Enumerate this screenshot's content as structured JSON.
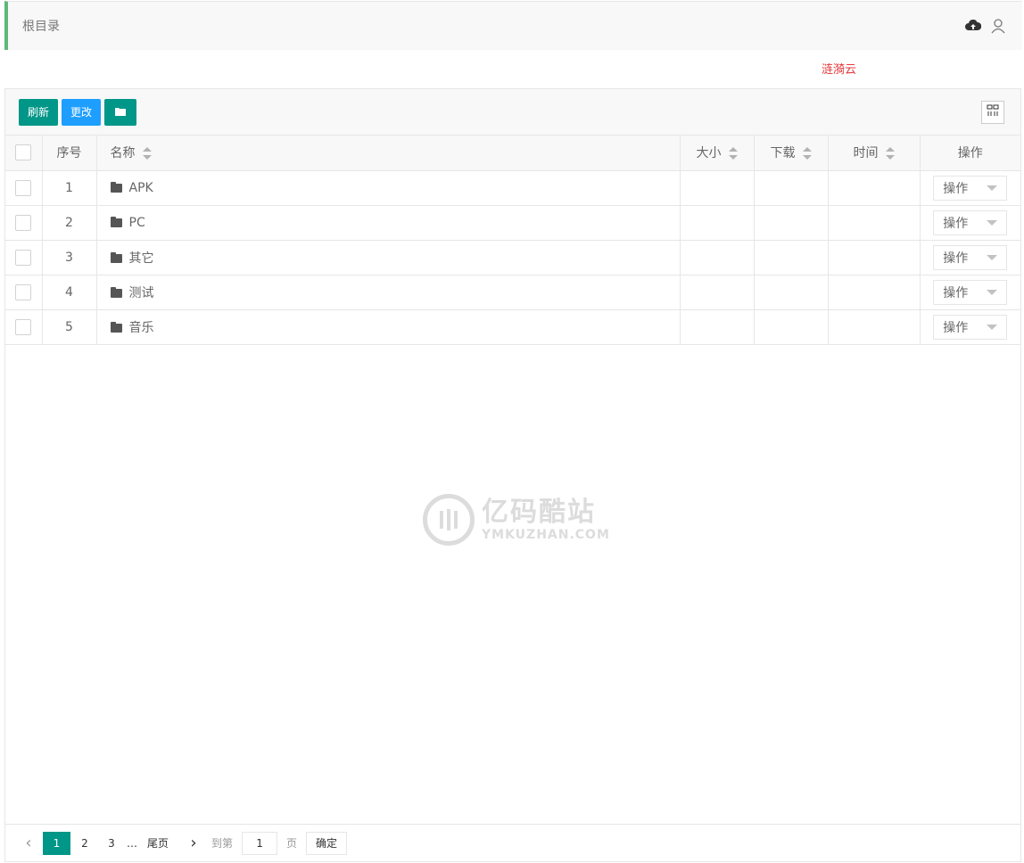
{
  "breadcrumb": {
    "current": "根目录"
  },
  "top_icons": [
    "cloud-upload-icon",
    "user-icon"
  ],
  "brand": {
    "text": "涟漪云",
    "color": "#e4393c"
  },
  "toolbar": {
    "refresh_label": "刷新",
    "change_label": "更改",
    "new_folder_icon": "folder-icon"
  },
  "table": {
    "headers": {
      "index": "序号",
      "name": "名称",
      "size": "大小",
      "download": "下载",
      "time": "时间",
      "action": "操作"
    },
    "rows": [
      {
        "index": "1",
        "name": "APK",
        "size": "",
        "download": "",
        "time": "",
        "action": "操作"
      },
      {
        "index": "2",
        "name": "PC",
        "size": "",
        "download": "",
        "time": "",
        "action": "操作"
      },
      {
        "index": "3",
        "name": "其它",
        "size": "",
        "download": "",
        "time": "",
        "action": "操作"
      },
      {
        "index": "4",
        "name": "测试",
        "size": "",
        "download": "",
        "time": "",
        "action": "操作"
      },
      {
        "index": "5",
        "name": "音乐",
        "size": "",
        "download": "",
        "time": "",
        "action": "操作"
      }
    ]
  },
  "watermark": {
    "title": "亿码酷站",
    "subtitle": "YMKUZHAN.COM"
  },
  "pager": {
    "pages": [
      "1",
      "2",
      "3"
    ],
    "current": "1",
    "ellipsis": "…",
    "last_label": "尾页",
    "goto_label": "到第",
    "goto_value": "1",
    "page_unit": "页",
    "confirm_label": "确定"
  },
  "colors": {
    "accent_green": "#009688",
    "accent_blue": "#1e9fff",
    "breadcrumb_bar": "#5fb878"
  }
}
